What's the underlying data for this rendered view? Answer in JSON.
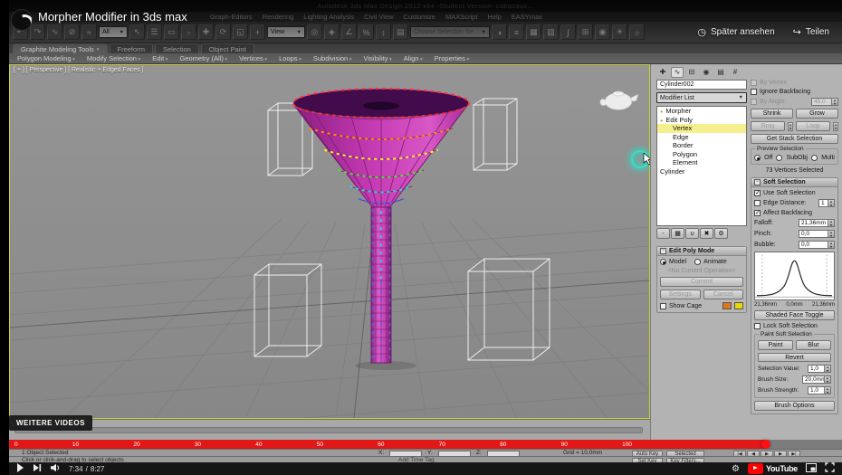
{
  "icons": {
    "clock": "◷",
    "share": "↪",
    "gear": "⚙",
    "caret": "▾",
    "caret_sel": "▼",
    "minus": "−"
  },
  "youtube": {
    "title": "Morpher Modifier in 3ds max",
    "watch_later": "Später ansehen",
    "share": "Teilen",
    "more_videos_label": "WEITERE VIDEOS",
    "time_current": "7:34",
    "time_separator": "/",
    "time_total": "8:27",
    "logo_text": "YouTube"
  },
  "max": {
    "titlebar_text": "Autodesk 3ds Max Design 2012 x64   -Student Version-   cabazaux...",
    "menus": [
      "Graph-Editors",
      "Rendering",
      "Lighting Analysis",
      "Civil View",
      "Customize",
      "MAXScript",
      "Help",
      "EASYmax"
    ],
    "toolbar": {
      "combo_all": "All",
      "combo_view": "View",
      "combo_named_selection": "Choose Selection Se",
      "icons_a": [
        {
          "name": "undo-icon",
          "glyph": "↶"
        },
        {
          "name": "redo-icon",
          "glyph": "↷"
        },
        {
          "name": "select-and-link-icon",
          "glyph": "∿"
        },
        {
          "name": "unlink-selection-icon",
          "glyph": "⊘"
        },
        {
          "name": "bind-to-spacewarp-icon",
          "glyph": "≈"
        }
      ],
      "icons_b": [
        {
          "name": "select-object-icon",
          "glyph": "↖"
        },
        {
          "name": "select-by-name-icon",
          "glyph": "☰"
        },
        {
          "name": "selection-region-icon",
          "glyph": "▭"
        },
        {
          "name": "window-crossing-icon",
          "glyph": "▫"
        },
        {
          "name": "select-and-move-icon",
          "glyph": "✚"
        },
        {
          "name": "select-and-rotate-icon",
          "glyph": "⟳"
        },
        {
          "name": "select-and-scale-icon",
          "glyph": "◱"
        },
        {
          "name": "select-and-manipulate-icon",
          "glyph": "+"
        }
      ],
      "icons_c": [
        {
          "name": "use-pivot-center-icon",
          "glyph": "◎"
        },
        {
          "name": "snaps-toggle-icon",
          "glyph": "◈"
        },
        {
          "name": "angle-snap-icon",
          "glyph": "∠"
        },
        {
          "name": "percent-snap-icon",
          "glyph": "%"
        },
        {
          "name": "spinner-snap-icon",
          "glyph": "↕"
        },
        {
          "name": "edit-named-selections-icon",
          "glyph": "▤"
        }
      ],
      "icons_d": [
        {
          "name": "mirror-icon",
          "glyph": "◑"
        },
        {
          "name": "align-icon",
          "glyph": "≡"
        },
        {
          "name": "layer-manager-icon",
          "glyph": "▦"
        },
        {
          "name": "graphite-ribbon-icon",
          "glyph": "▨"
        },
        {
          "name": "curve-editor-icon",
          "glyph": "∫"
        },
        {
          "name": "schematic-view-icon",
          "glyph": "⊞"
        },
        {
          "name": "material-editor-icon",
          "glyph": "◉"
        },
        {
          "name": "render-setup-icon",
          "glyph": "☀"
        },
        {
          "name": "render-production-icon",
          "glyph": "☼"
        }
      ]
    },
    "ribbon": {
      "tabs": [
        "Graphite Modeling Tools",
        "Freeform",
        "Selection",
        "Object Paint"
      ],
      "panels": [
        "Polygon Modeling",
        "Modify Selection",
        "Edit",
        "Geometry (All)",
        "Vertices",
        "Loops",
        "Subdivision",
        "Visibility",
        "Align",
        "Properties"
      ]
    },
    "viewport": {
      "label": "[ + ] [ Perspective ] [ Realistic + Edged Faces ]"
    },
    "panel": {
      "tab_glyphs": [
        "✚",
        "∿",
        "⊟",
        "◉",
        "▤",
        "#"
      ],
      "object_name": "Cylinder002",
      "modifier_list": "Modifier List",
      "stack": [
        "Morpher",
        "Edit Poly",
        "Vertex",
        "Edge",
        "Border",
        "Polygon",
        "Element",
        "Cylinder"
      ],
      "stack_buttons": [
        {
          "name": "pin-stack-button",
          "glyph": "-"
        },
        {
          "name": "show-end-result-button",
          "glyph": "▦"
        },
        {
          "name": "make-unique-button",
          "glyph": "∪"
        },
        {
          "name": "remove-modifier-button",
          "glyph": "✖"
        },
        {
          "name": "configure-modifier-sets-button",
          "glyph": "⚙"
        }
      ]
    },
    "selection": {
      "by_vertex": "By Vertex",
      "ignore_backfacing": "Ignore Backfacing",
      "by_angle": "By Angle:",
      "by_angle_value": "45,0",
      "shrink": "Shrink",
      "grow": "Grow",
      "ring": "Ring",
      "loop": "Loop",
      "get_stack": "Get Stack Selection",
      "preview_label": "Preview Selection",
      "preview_off": "Off",
      "preview_subobj": "SubObj",
      "preview_multi": "Multi",
      "status": "73 Vertices Selected"
    },
    "soft": {
      "header": "Soft Selection",
      "use": "Use Soft Selection",
      "edge_distance": "Edge Distance:",
      "edge_distance_value": "1",
      "affect_backfacing": "Affect Backfacing",
      "falloff_label": "Falloff:",
      "falloff_value": "21,36mm",
      "pinch_label": "Pinch:",
      "pinch_value": "0,0",
      "bubble_label": "Bubble:",
      "bubble_value": "0,0",
      "curve_labels": [
        "21,36mm",
        "0,0mm",
        "21,36mm"
      ],
      "shaded_face": "Shaded Face Toggle",
      "lock": "Lock Soft Selection",
      "paint_group": "Paint Soft Selection",
      "paint": "Paint",
      "blur": "Blur",
      "revert": "Revert",
      "selection_value_label": "Selection Value:",
      "selection_value": "1,0",
      "brush_size_label": "Brush Size:",
      "brush_size": "20,0mm",
      "brush_strength_label": "Brush Strength:",
      "brush_strength": "1,0",
      "brush_options": "Brush Options"
    },
    "editpoly": {
      "header": "Edit Poly Mode",
      "model": "Model",
      "animate": "Animate",
      "no_operation": "<No Current Operation>",
      "commit": "Commit",
      "settings": "Settings",
      "cancel": "Cancel",
      "show_cage": "Show Cage"
    },
    "timeline_ticks": [
      "0",
      "10",
      "20",
      "30",
      "40",
      "50",
      "60",
      "70",
      "80",
      "90",
      "100"
    ],
    "status": {
      "selected": "1 Object Selected",
      "prompt": "Click or click-and-drag to select objects",
      "x": "X:",
      "y": "Y:",
      "z": "Z:",
      "grid": "Grid = 10,0mm",
      "add_time_tag": "Add Time Tag",
      "auto_key": "Auto Key",
      "selected_combo": "Selected",
      "set_key": "Set Key",
      "key_filters": "Key Filters...",
      "transport": [
        {
          "name": "go-to-start-button",
          "glyph": "|◀"
        },
        {
          "name": "previous-frame-button",
          "glyph": "◀"
        },
        {
          "name": "play-animation-button",
          "glyph": "▶"
        },
        {
          "name": "next-frame-button",
          "glyph": "▶"
        },
        {
          "name": "go-to-end-button",
          "glyph": "▶|"
        }
      ]
    }
  }
}
